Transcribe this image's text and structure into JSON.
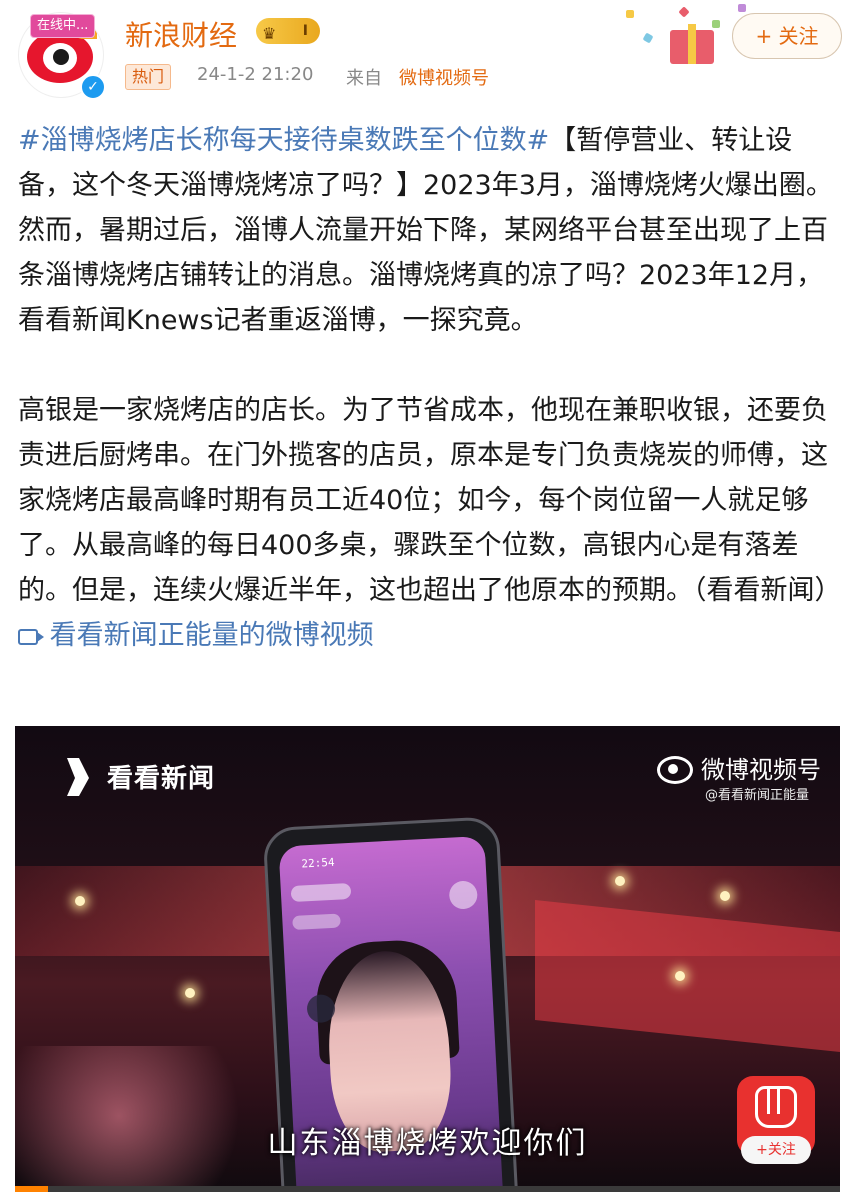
{
  "header": {
    "live_tag": "在线中...",
    "name": "新浪财经",
    "vip_level": "I",
    "hot_tag": "热门",
    "time": "24-1-2 21:20",
    "source_label": "来自",
    "source": "微博视频号",
    "follow_label": "+ 关注"
  },
  "post": {
    "topic": "#淄博烧烤店长称每天接待桌数跌至个位数#",
    "para1_rest": "【暂停营业、转让设备，这个冬天淄博烧烤凉了吗？】2023年3月，淄博烧烤火爆出圈。然而，暑期过后，淄博人流量开始下降，某网络平台甚至出现了上百条淄博烧烤店铺转让的消息。淄博烧烤真的凉了吗？2023年12月，看看新闻Knews记者重返淄博，一探究竟。",
    "para2": "高银是一家烧烤店的店长。为了节省成本，他现在兼职收银，还要负责进后厨烤串。在门外揽客的店员，原本是专门负责烧炭的师傅，这家烧烤店最高峰时期有员工近40位；如今，每个岗位留一人就足够了。从最高峰的每日400多桌，骤跌至个位数，高银内心是有落差的。但是，连续火爆近半年，这也超出了他原本的预期。（看看新闻）",
    "video_link": "看看新闻正能量的微博视频"
  },
  "video": {
    "brand_label": "看看新闻",
    "weibo_label": "微博视频号",
    "weibo_account": "@看看新闻正能量",
    "phone_time": "22:54",
    "subtitle": "山东淄博烧烤欢迎你们",
    "follow_label": "+关注",
    "progress": 0.04
  },
  "colors": {
    "accent": "#e36a11",
    "link": "#4a79b6",
    "follow_red": "#e8312f",
    "progress": "#ff8200"
  }
}
